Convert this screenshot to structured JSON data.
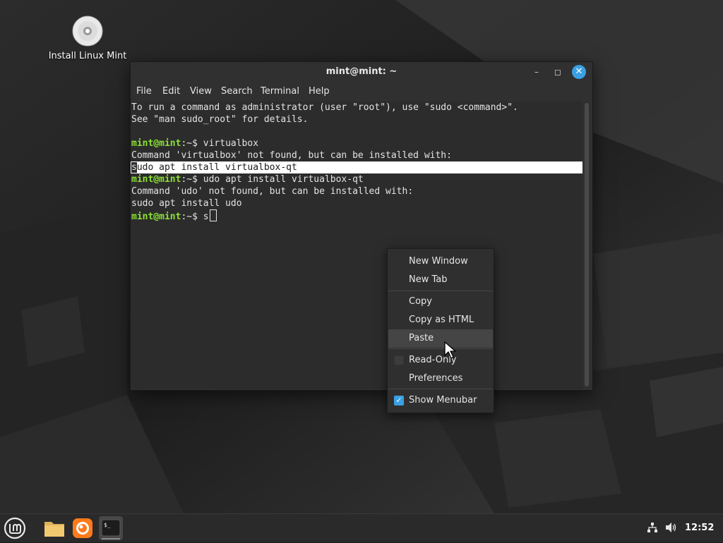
{
  "desktop": {
    "icon_label": "Install Linux Mint",
    "icon_name": "dvd-installer-icon"
  },
  "window": {
    "title": "mint@mint: ~",
    "controls": [
      "minimize",
      "maximize",
      "close"
    ],
    "accent": "#3aa0e3"
  },
  "menubar": {
    "file": "File",
    "edit": "Edit",
    "view": "View",
    "search": "Search",
    "terminal": "Terminal",
    "help": "Help"
  },
  "terminal": {
    "line1": "To run a command as administrator (user \"root\"), use \"sudo <command>\".",
    "line2": "See \"man sudo_root\" for details.",
    "prompt_user": "mint@mint",
    "prompt_path": ":~$ ",
    "cmd1": "virtualbox",
    "out1": "Command 'virtualbox' not found, but can be installed with:",
    "selected_first_char": "s",
    "selected_rest": "udo apt install virtualbox-qt",
    "cmd2": "udo apt install virtualbox-qt",
    "out2": "Command 'udo' not found, but can be installed with:",
    "out3": "sudo apt install udo",
    "cmd3": "s",
    "prompt_color": "#8ae234"
  },
  "context_menu": {
    "new_window": "New Window",
    "new_tab": "New Tab",
    "copy": "Copy",
    "copy_html": "Copy as HTML",
    "paste": "Paste",
    "read_only": "Read-Only",
    "read_only_checked": false,
    "preferences": "Preferences",
    "show_menubar": "Show Menubar",
    "show_menubar_checked": true,
    "hovered_item": "Paste"
  },
  "taskbar": {
    "menu_icon": "linux-mint-menu-icon",
    "apps": [
      "files-folder-icon",
      "firefox-icon",
      "terminal-icon"
    ],
    "active_app": "terminal-icon",
    "tray": [
      "network-icon",
      "volume-icon"
    ],
    "clock": "12:52"
  }
}
